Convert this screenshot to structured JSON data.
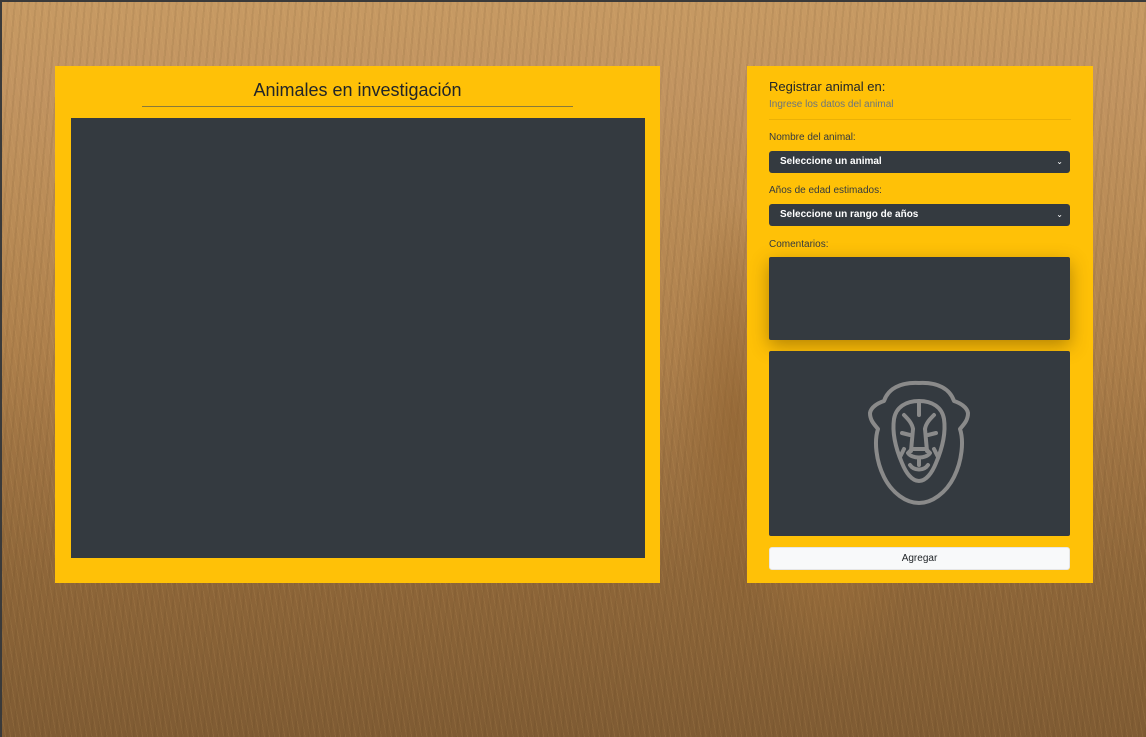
{
  "left_panel": {
    "title": "Animales en investigación"
  },
  "form": {
    "title": "Registrar animal en:",
    "subtitle": "Ingrese los datos del animal",
    "name_label": "Nombre del animal:",
    "name_select_value": "Seleccione un animal",
    "age_label": "Años de edad estimados:",
    "age_select_value": "Seleccione un rango de años",
    "comments_label": "Comentarios:",
    "comments_value": "",
    "preview_icon": "lion-icon",
    "add_button_label": "Agregar"
  },
  "colors": {
    "panel": "#ffc107",
    "dark": "#343a40",
    "button": "#f8f9fa"
  }
}
